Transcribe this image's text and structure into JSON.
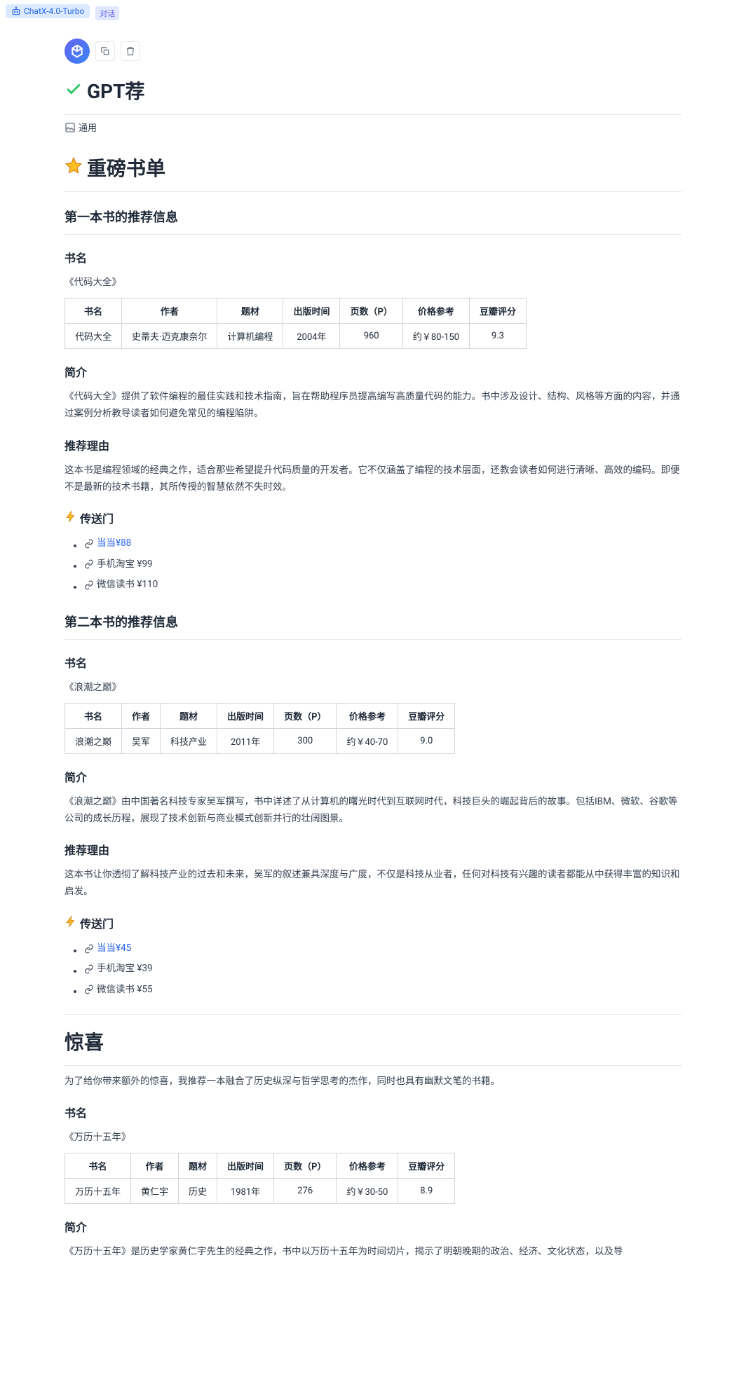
{
  "tab": {
    "label": "ChatX-4.0-Turbo",
    "badge": "对话"
  },
  "image_alt": "通用",
  "headings": {
    "gpt": "GPT荐",
    "booklist": "重磅书单",
    "book1_section": "第一本书的推荐信息",
    "book2_section": "第二本书的推荐信息",
    "surprise": "惊喜",
    "name": "书名",
    "intro": "简介",
    "reason": "推荐理由",
    "portal": "传送门"
  },
  "table_headers": {
    "name": "书名",
    "author": "作者",
    "subject": "题材",
    "pubtime": "出版时间",
    "pages": "页数（P）",
    "price": "价格参考",
    "rating": "豆瓣评分"
  },
  "book1": {
    "title_quoted": "《代码大全》",
    "name": "代码大全",
    "author": "史蒂夫·迈克康奈尔",
    "subject": "计算机编程",
    "pubtime": "2004年",
    "pages": "960",
    "price": "约￥80-150",
    "rating": "9.3",
    "intro": "《代码大全》提供了软件编程的最佳实践和技术指南，旨在帮助程序员提高编写高质量代码的能力。书中涉及设计、结构、风格等方面的内容，并通过案例分析教导读者如何避免常见的编程陷阱。",
    "reason": "这本书是编程领域的经典之作，适合那些希望提升代码质量的开发者。它不仅涵盖了编程的技术层面，还教会读者如何进行清晰、高效的编码。即便不是最新的技术书籍，其所传授的智慧依然不失时效。",
    "links": {
      "dangdang": "当当¥88",
      "taobao": "手机淘宝 ¥99",
      "weread": "微信读书 ¥110"
    }
  },
  "book2": {
    "title_quoted": "《浪潮之巅》",
    "name": "浪潮之巅",
    "author": "吴军",
    "subject": "科技产业",
    "pubtime": "2011年",
    "pages": "300",
    "price": "约￥40-70",
    "rating": "9.0",
    "intro": "《浪潮之巅》由中国著名科技专家吴军撰写，书中详述了从计算机的曙光时代到互联网时代，科技巨头的崛起背后的故事。包括IBM、微软、谷歌等公司的成长历程，展现了技术创新与商业模式创新并行的壮阔图景。",
    "reason": "这本书让你透彻了解科技产业的过去和未来，吴军的叙述兼具深度与广度，不仅是科技从业者，任何对科技有兴趣的读者都能从中获得丰富的知识和启发。",
    "links": {
      "dangdang": "当当¥45",
      "taobao": "手机淘宝 ¥39",
      "weread": "微信读书 ¥55"
    }
  },
  "surprise": {
    "intro": "为了给你带来额外的惊喜，我推荐一本融合了历史纵深与哲学思考的杰作，同时也具有幽默文笔的书籍。",
    "title_quoted": "《万历十五年》",
    "name": "万历十五年",
    "author": "黄仁宇",
    "subject": "历史",
    "pubtime": "1981年",
    "pages": "276",
    "price": "约￥30-50",
    "rating": "8.9",
    "desc": "《万历十五年》是历史学家黄仁宇先生的经典之作，书中以万历十五年为时间切片，揭示了明朝晚期的政治、经济、文化状态，以及导"
  }
}
